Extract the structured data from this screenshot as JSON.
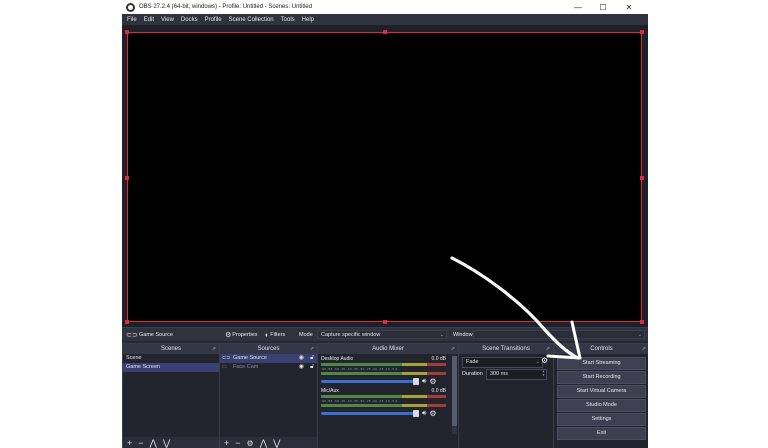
{
  "window": {
    "title": "OBS 27.2.4 (64-bit, windows) - Profile: Untitled - Scenes: Untitled",
    "minimize": "—",
    "maximize": "☐",
    "close": "✕"
  },
  "menu": [
    "File",
    "Edit",
    "View",
    "Docks",
    "Profile",
    "Scene Collection",
    "Tools",
    "Help"
  ],
  "context_bar": {
    "source_name": "Game Source",
    "properties": "Properties",
    "filters": "Filters",
    "mode_label": "Mode",
    "mode_value": "Capture specific window",
    "window_label": "Window"
  },
  "scenes": {
    "header": "Scenes",
    "items": [
      "Scene",
      "Game Screen"
    ],
    "selected": 1
  },
  "sources": {
    "header": "Sources",
    "items": [
      {
        "name": "Game Source",
        "selected": true
      },
      {
        "name": "Face Cam",
        "selected": false
      }
    ]
  },
  "mixer": {
    "header": "Audio Mixer",
    "channels": [
      {
        "name": "Desktop Audio",
        "db": "0.0 dB"
      },
      {
        "name": "Mic/Aux",
        "db": "0.0 dB"
      }
    ],
    "ticks": "-60 -55 -50 -45 -40 -35 -30 -25 -20 -15 -10 -5 0"
  },
  "transitions": {
    "header": "Scene Transitions",
    "value": "Fade",
    "duration_label": "Duration",
    "duration_value": "300 ms"
  },
  "controls": {
    "header": "Controls",
    "buttons": [
      "Start Streaming",
      "Start Recording",
      "Start Virtual Camera",
      "Studio Mode",
      "Settings",
      "Exit"
    ]
  },
  "footer_icons": {
    "add": "+",
    "remove": "−",
    "up": "⋀",
    "down": "⋁",
    "gear": "⚙"
  }
}
